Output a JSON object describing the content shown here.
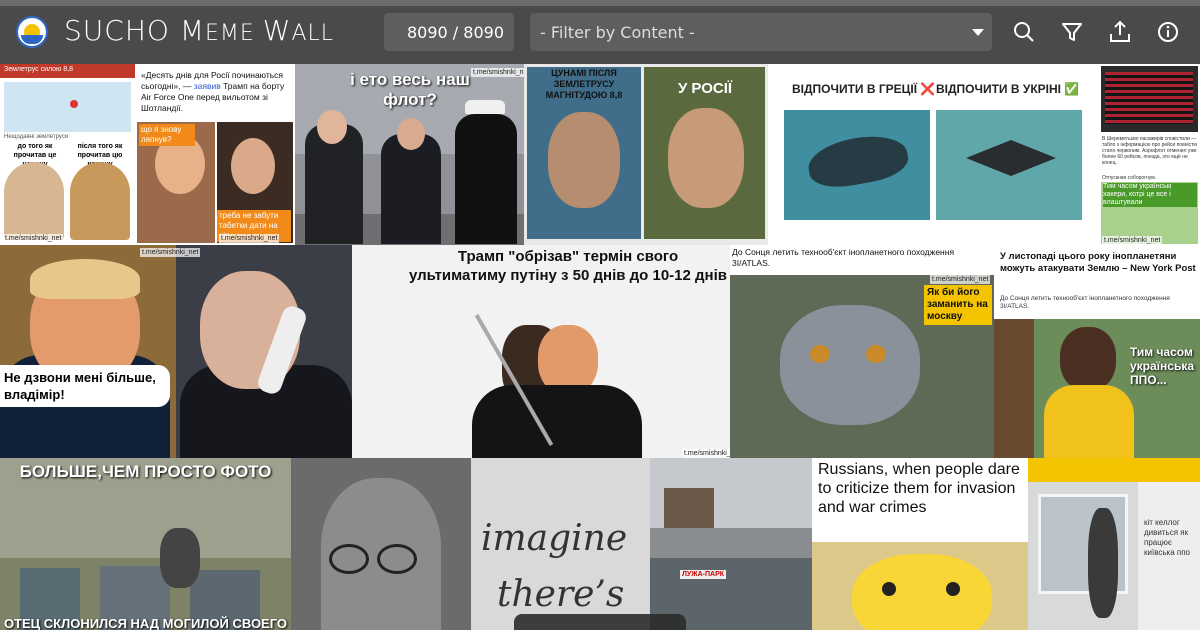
{
  "header": {
    "title_big": "SUCHO ",
    "title_m": "M",
    "title_eme": "EME ",
    "title_w": "W",
    "title_all": "ALL",
    "counter": "8090 / 8090",
    "filter_placeholder": "- Filter by Content -",
    "icons": [
      "search-icon",
      "filter-icon",
      "upload-icon",
      "info-icon"
    ]
  },
  "tiles": {
    "t1": {
      "line1": "Землетрус силою 8,8",
      "line2": "Нещодавні землетруси",
      "left": "до того як прочитав це новину",
      "right": "після того як прочитав цю новину",
      "wm": "t.me/smishnki_net"
    },
    "t2": {
      "quote": "«Десять днів для Росії починаються сьогодні», — ",
      "link": "заявив",
      "rest": " Трамп на борту Air Force One перед вильотом зі Шотландії.",
      "bubble1": "що я знову ляпнув?",
      "bubble2": "треба не забути табетки дати на ніч",
      "wm": "t.me/smishnki_net"
    },
    "t3": {
      "caption": "і ето весь наш флот?",
      "wm": "t.me/smishnki_net"
    },
    "t4": {
      "left": "ЦУНАМІ ПІСЛЯ ЗЕМЛЕТРУСУ МАГНІТУДОЮ 8,8",
      "right": "У РОСІЇ"
    },
    "t5": {
      "left": "ВІДПОЧИТИ В ГРЕЦІЇ ❌",
      "right": "ВІДПОЧИТИ В УКРІНІ ✅"
    },
    "t6": {
      "text": "В Шереметьєво пасажирів сповістили — табло з інформацією про рейси повністю стало червоним. Аэрофлот отменил уже более 60 рейсов, поезда, это ещё не конец.",
      "sub": "Отпускная соборогнум.",
      "caption": "Тим часом українські хакери, котрі це все і влаштували",
      "wm": "t.me/smishnki_net"
    },
    "t7": {
      "bubble": "Не дзвони мені більше, владімір!",
      "wm": "t.me/smishnki_net"
    },
    "t8": {
      "caption": "Трамп \"обрізав\" термін свого ультиматиму путіну з 50 днів до 10-12 днів",
      "wm": "t.me/smishnki_net"
    },
    "t9": {
      "caption": "До Сонця летить технооб'єкт інопланетного походження 3I/ATLAS.",
      "bubble": "Як би його заманить на москву",
      "wm": "t.me/smishnki_net"
    },
    "t10": {
      "head": "У листопаді цього року інопланетяни можуть атакувати Землю – New York Post",
      "sub": "До Сонця летить технооб'єкт інопланетного походження 3I/ATLAS.",
      "caption": "Тим часом українська ППО..."
    },
    "t11": {
      "top": "БОЛЬШЕ,ЧЕМ ПРОСТО ФОТО",
      "bottom": "ОТЕЦ СКЛОНИЛСЯ НАД МОГИЛОЙ СВОЕГО"
    },
    "t12": {
      "line1": "imagine",
      "line2": "there’s"
    },
    "t13": {
      "sign": "ЛУЖА-ПАРК"
    },
    "t14": {
      "caption": "Russians, when people dare to criticize them for invasion and war crimes"
    },
    "t15": {
      "caption": "кіт келлог дивиться як працює київська ппо"
    }
  },
  "colors": {
    "topbar": "#4a4a4a",
    "control": "#5e5e5e",
    "accent_yellow": "#f5c400"
  }
}
